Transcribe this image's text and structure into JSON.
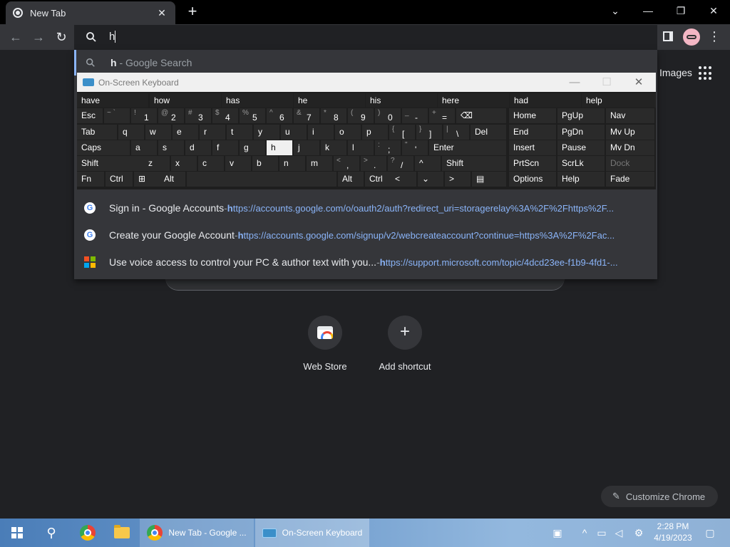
{
  "browser": {
    "tab_title": "New Tab",
    "tab_close": "✕",
    "new_tab": "+",
    "win_controls": {
      "tabsearch": "⌄",
      "minimize": "—",
      "restore": "❐",
      "close": "✕"
    },
    "nav": {
      "back": "←",
      "forward": "→",
      "reload": "↻"
    },
    "omnibox_text": "h",
    "menu_dots": "⋮"
  },
  "dropdown": {
    "search_suggestion": {
      "query": "h",
      "suffix": " - Google Search"
    },
    "history": [
      {
        "title": "Sign in - Google Accounts",
        "sep": " - ",
        "url_bold": "h",
        "url_rest": "ttps://accounts.google.com/o/oauth2/auth?redirect_uri=storagerelay%3A%2F%2Fhttps%2F...",
        "icon": "google-icon"
      },
      {
        "title": "Create your Google Account",
        "sep": " - ",
        "url_bold": "h",
        "url_rest": "ttps://accounts.google.com/signup/v2/webcreateaccount?continue=https%3A%2F%2Fac...",
        "icon": "google-icon"
      },
      {
        "title": "Use voice access to control your PC & author text with you...",
        "sep": " - ",
        "url_bold": "h",
        "url_rest": "ttps://support.microsoft.com/topic/4dcd23ee-f1b9-4fd1-...",
        "icon": "microsoft-icon"
      }
    ]
  },
  "page": {
    "images_link": "Images",
    "shortcuts": [
      {
        "label": "Web Store"
      },
      {
        "label": "Add shortcut"
      }
    ],
    "add_symbol": "+",
    "customize_label": "Customize Chrome",
    "customize_icon": "✎"
  },
  "osk": {
    "title": "On-Screen Keyboard",
    "controls": {
      "minimize": "—",
      "maximize": "☐",
      "close": "✕"
    },
    "predictions": [
      "have",
      "how",
      "has",
      "he",
      "his",
      "here",
      "had",
      "help"
    ],
    "rows": [
      [
        {
          "l": "Esc"
        },
        {
          "a": "~ `",
          "m": ""
        },
        {
          "a": "!",
          "m": "1"
        },
        {
          "a": "@",
          "m": "2"
        },
        {
          "a": "#",
          "m": "3"
        },
        {
          "a": "$",
          "m": "4"
        },
        {
          "a": "%",
          "m": "5"
        },
        {
          "a": "^",
          "m": "6"
        },
        {
          "a": "&",
          "m": "7"
        },
        {
          "a": "*",
          "m": "8"
        },
        {
          "a": "(",
          "m": "9"
        },
        {
          "a": ")",
          "m": "0"
        },
        {
          "a": "_",
          "m": "-"
        },
        {
          "a": "+",
          "m": "="
        },
        {
          "l": "⌫"
        }
      ],
      [
        {
          "l": "Tab"
        },
        {
          "l": "q"
        },
        {
          "l": "w"
        },
        {
          "l": "e"
        },
        {
          "l": "r"
        },
        {
          "l": "t"
        },
        {
          "l": "y"
        },
        {
          "l": "u"
        },
        {
          "l": "i"
        },
        {
          "l": "o"
        },
        {
          "l": "p"
        },
        {
          "a": "{",
          "m": "["
        },
        {
          "a": "}",
          "m": "]"
        },
        {
          "a": "|",
          "m": "\\"
        },
        {
          "l": "Del"
        }
      ],
      [
        {
          "l": "Caps"
        },
        {
          "l": "a"
        },
        {
          "l": "s"
        },
        {
          "l": "d"
        },
        {
          "l": "f"
        },
        {
          "l": "g"
        },
        {
          "l": "h"
        },
        {
          "l": "j"
        },
        {
          "l": "k"
        },
        {
          "l": "l"
        },
        {
          "a": ":",
          "m": ";"
        },
        {
          "a": "\"",
          "m": "'"
        },
        {
          "l": "Enter"
        }
      ],
      [
        {
          "l": "Shift"
        },
        {
          "l": "z"
        },
        {
          "l": "x"
        },
        {
          "l": "c"
        },
        {
          "l": "v"
        },
        {
          "l": "b"
        },
        {
          "l": "n"
        },
        {
          "l": "m"
        },
        {
          "a": "<",
          "m": ","
        },
        {
          "a": ">",
          "m": "."
        },
        {
          "a": "?",
          "m": "/"
        },
        {
          "l": "^"
        },
        {
          "l": "Shift"
        }
      ],
      [
        {
          "l": "Fn"
        },
        {
          "l": "Ctrl"
        },
        {
          "l": "⊞"
        },
        {
          "l": "Alt"
        },
        {
          "l": ""
        },
        {
          "l": "Alt"
        },
        {
          "l": "Ctrl"
        },
        {
          "l": "<"
        },
        {
          "l": "⌄"
        },
        {
          "l": ">"
        },
        {
          "l": "▤"
        }
      ]
    ],
    "nav_keys": [
      [
        "Home",
        "PgUp",
        "Nav"
      ],
      [
        "End",
        "PgDn",
        "Mv Up"
      ],
      [
        "Insert",
        "Pause",
        "Mv Dn"
      ],
      [
        "PrtScn",
        "ScrLk",
        "Dock"
      ],
      [
        "Options",
        "Help",
        "Fade"
      ]
    ]
  },
  "taskbar": {
    "chrome_window_label": "New Tab - Google ...",
    "osk_label": "On-Screen Keyboard",
    "time": "2:28 PM",
    "date": "4/19/2023",
    "search_icon": "⚲"
  }
}
